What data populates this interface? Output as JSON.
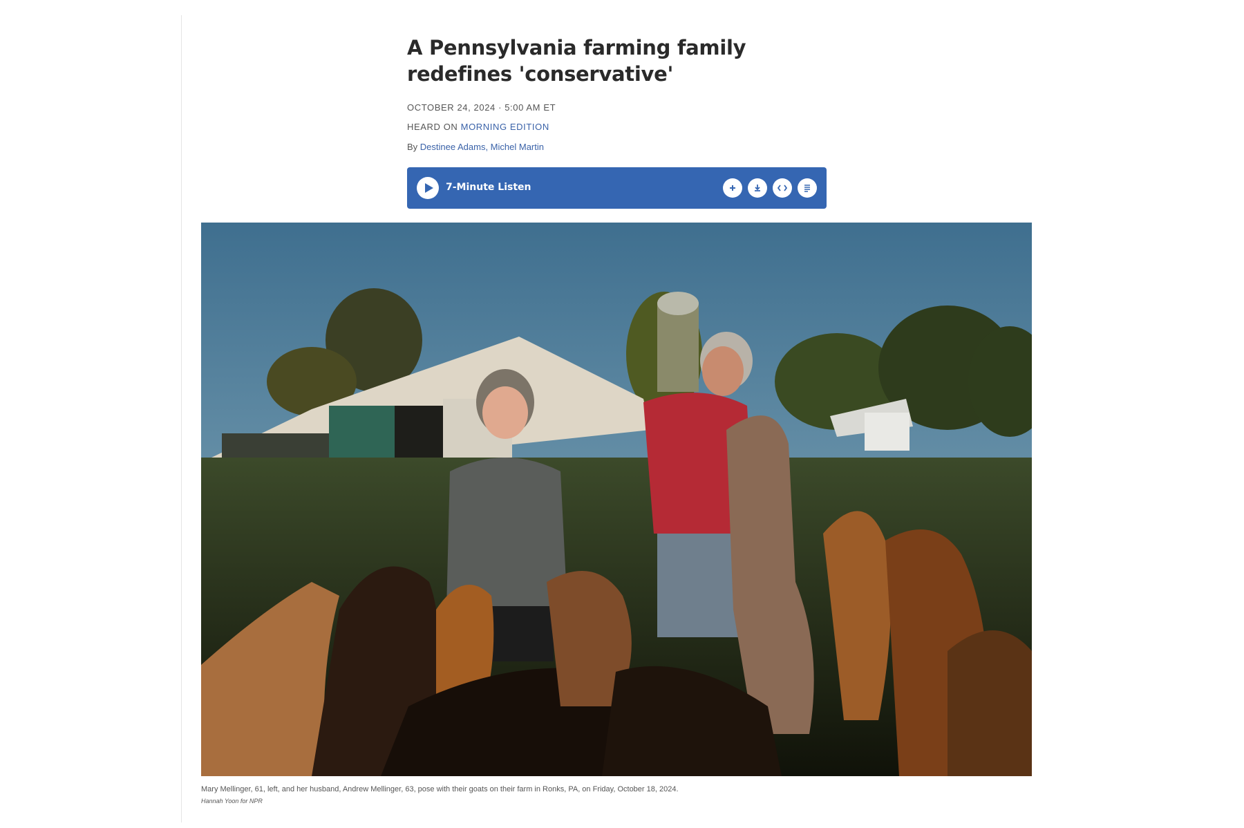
{
  "article": {
    "headline": "A Pennsylvania farming family redefines 'conservative'",
    "dateline": "OCTOBER 24, 2024 · 5:00 AM ET",
    "heard_on_prefix": "HEARD ON ",
    "heard_on_program": "MORNING EDITION",
    "byline_prefix": "By ",
    "authors": "Destinee Adams, Michel Martin"
  },
  "player": {
    "title": "7-Minute Listen",
    "icons": [
      "play-icon",
      "add-icon",
      "download-icon",
      "embed-icon",
      "transcript-icon"
    ],
    "accent": "#3566b2"
  },
  "image": {
    "caption": "Mary Mellinger, 61, left, and her husband, Andrew Mellinger, 63, pose with their goats on their farm in Ronks, PA, on Friday, October 18, 2024.",
    "credit": "Hannah Yoon for NPR"
  }
}
